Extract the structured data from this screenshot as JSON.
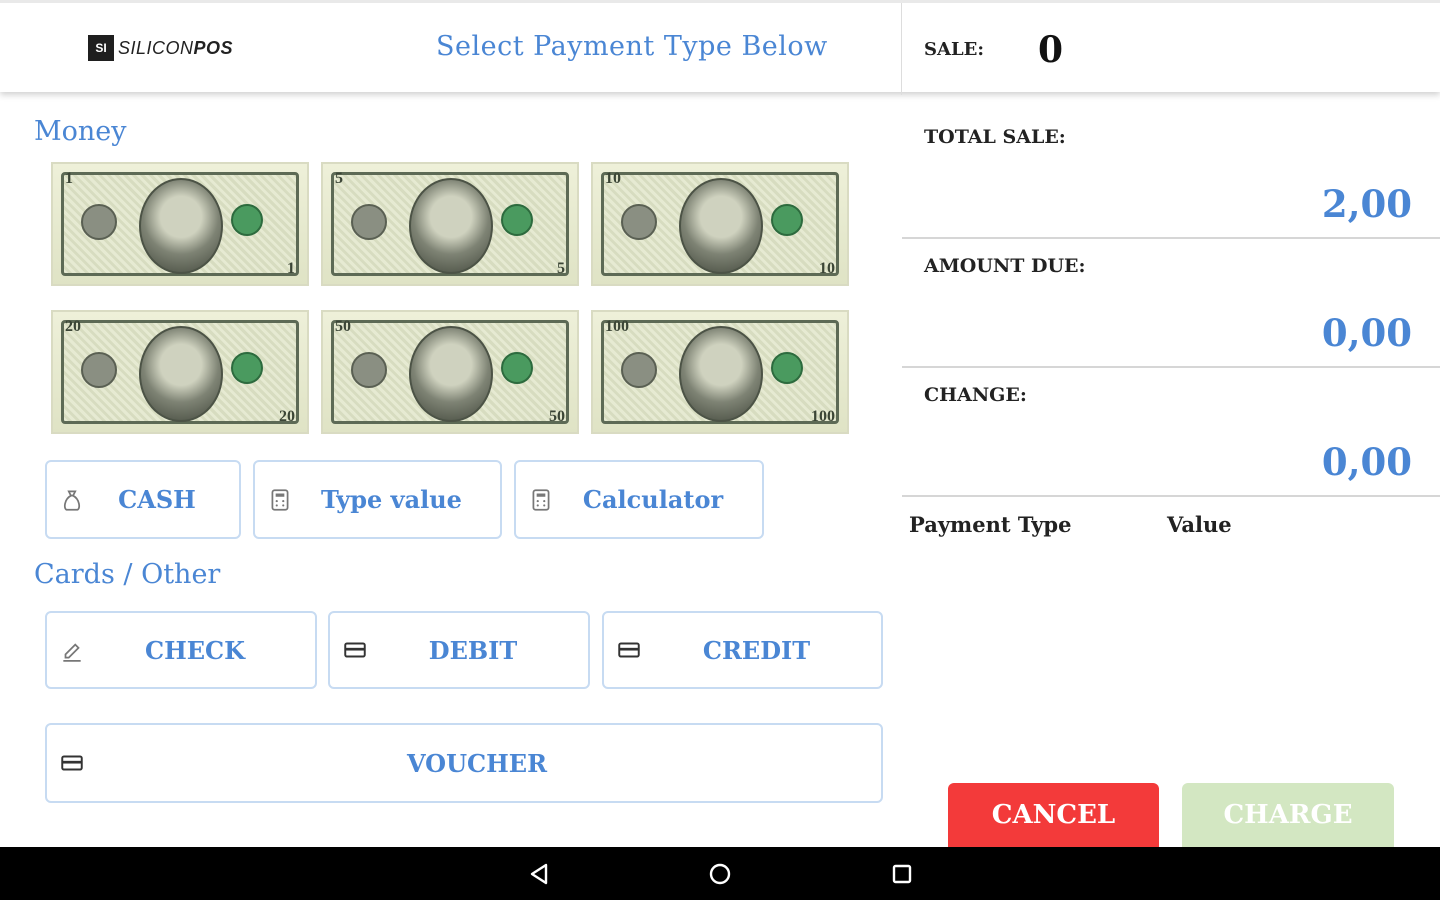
{
  "header": {
    "logo_mark": "SI",
    "logo_text_a": "SILICON",
    "logo_text_b": "POS",
    "title": "Select Payment Type Below",
    "sale_label": "SALE:",
    "sale_value": "0"
  },
  "money": {
    "title": "Money",
    "bills": [
      {
        "denomination": "1",
        "name": "one-dollar"
      },
      {
        "denomination": "5",
        "name": "five-dollar"
      },
      {
        "denomination": "10",
        "name": "ten-dollar"
      },
      {
        "denomination": "20",
        "name": "twenty-dollar"
      },
      {
        "denomination": "50",
        "name": "fifty-dollar"
      },
      {
        "denomination": "100",
        "name": "hundred-dollar"
      }
    ],
    "cash_label": "CASH",
    "type_value_label": "Type value",
    "calculator_label": "Calculator"
  },
  "cards": {
    "title": "Cards / Other",
    "check_label": "CHECK",
    "debit_label": "DEBIT",
    "credit_label": "CREDIT",
    "voucher_label": "VOUCHER"
  },
  "summary": {
    "total_sale_label": "TOTAL SALE:",
    "total_sale_value": "2,00",
    "amount_due_label": "AMOUNT DUE:",
    "amount_due_value": "0,00",
    "change_label": "CHANGE:",
    "change_value": "0,00",
    "col_payment_type": "Payment Type",
    "col_value": "Value"
  },
  "actions": {
    "cancel_label": "CANCEL",
    "charge_label": "CHARGE"
  },
  "colors": {
    "accent": "#4a86d4",
    "cancel": "#f33a3a",
    "charge_disabled": "#d3e7c2"
  },
  "icons": [
    "money-bag-icon",
    "calculator-icon",
    "pencil-icon",
    "card-icon",
    "back-icon",
    "home-icon",
    "recents-icon"
  ]
}
